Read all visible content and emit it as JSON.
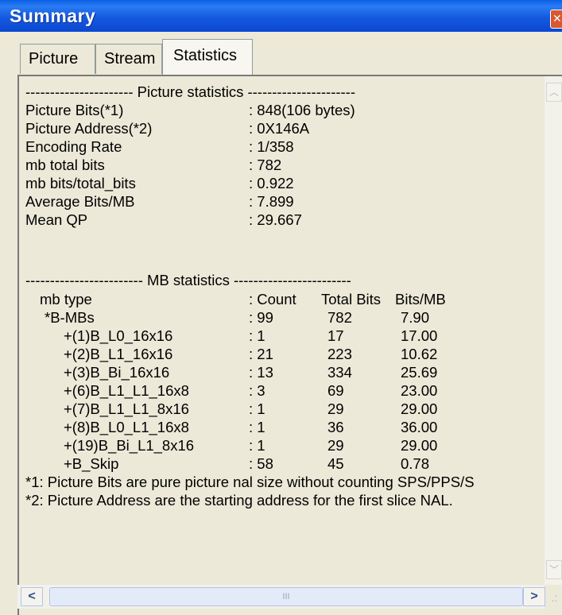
{
  "window": {
    "title": "Summary",
    "close_glyph": "✕"
  },
  "tabs": [
    {
      "label": "Picture"
    },
    {
      "label": "Stream"
    },
    {
      "label": "Statistics"
    }
  ],
  "picture_stats": {
    "header": "---------------------- Picture statistics ----------------------",
    "rows": [
      {
        "label": "Picture Bits(*1)",
        "value": ": 848(106 bytes)"
      },
      {
        "label": "Picture Address(*2)",
        "value": ": 0X146A"
      },
      {
        "label": "Encoding Rate",
        "value": ": 1/358"
      },
      {
        "label": "mb total bits",
        "value": ": 782"
      },
      {
        "label": "mb bits/total_bits",
        "value": ": 0.922"
      },
      {
        "label": "Average Bits/MB",
        "value": ": 7.899"
      },
      {
        "label": "Mean QP",
        "value": ": 29.667"
      }
    ]
  },
  "mb_stats": {
    "header": "------------------------ MB statistics ------------------------",
    "columns": {
      "type": "mb type",
      "count": ": Count",
      "total": "Total Bits",
      "per": "Bits/MB"
    },
    "rows": [
      {
        "type": "*B-MBs",
        "count": ": 99",
        "total": "782",
        "per": "7.90"
      },
      {
        "type": "+(1)B_L0_16x16",
        "count": ": 1",
        "total": "17",
        "per": "17.00"
      },
      {
        "type": "+(2)B_L1_16x16",
        "count": ": 21",
        "total": "223",
        "per": "10.62"
      },
      {
        "type": "+(3)B_Bi_16x16",
        "count": ": 13",
        "total": "334",
        "per": "25.69"
      },
      {
        "type": "+(6)B_L1_L1_16x8",
        "count": ": 3",
        "total": "69",
        "per": "23.00"
      },
      {
        "type": "+(7)B_L1_L1_8x16",
        "count": ": 1",
        "total": "29",
        "per": "29.00"
      },
      {
        "type": "+(8)B_L0_L1_16x8",
        "count": ": 1",
        "total": "36",
        "per": "36.00"
      },
      {
        "type": "+(19)B_Bi_L1_8x16",
        "count": ": 1",
        "total": "29",
        "per": "29.00"
      },
      {
        "type": "+B_Skip",
        "count": ": 58",
        "total": "45",
        "per": "0.78"
      }
    ]
  },
  "notes": [
    "*1: Picture Bits are pure picture nal size without counting SPS/PPS/S",
    "*2: Picture Address are the starting address for the first slice NAL."
  ],
  "scrollbar": {
    "up_glyph": "︿",
    "down_glyph": "﹀",
    "left_glyph": "<",
    "right_glyph": ">",
    "thumb_grip": "III",
    "resize_grip": ".:"
  },
  "icons": {
    "close": "close-icon",
    "scroll_left": "arrow-left-icon",
    "scroll_right": "arrow-right-icon",
    "scroll_up": "arrow-up-icon",
    "scroll_down": "arrow-down-icon"
  }
}
